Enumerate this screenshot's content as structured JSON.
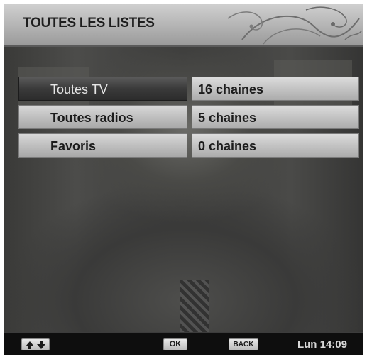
{
  "header": {
    "title": "TOUTES LES LISTES"
  },
  "lists": [
    {
      "label": "Toutes TV",
      "count": "16 chaines",
      "selected": true
    },
    {
      "label": "Toutes radios",
      "count": "5 chaines",
      "selected": false
    },
    {
      "label": "Favoris",
      "count": "0 chaines",
      "selected": false
    }
  ],
  "footer": {
    "nav_icon": "up-down-arrows-icon",
    "ok_label": "OK",
    "back_label": "BACK",
    "clock": "Lun 14:09"
  },
  "colors": {
    "header_bg": "#b8b8b8",
    "selected_item": "#3a3a3a",
    "item_bg": "#c4c4c4",
    "footer_bg": "#0e0e0e"
  }
}
